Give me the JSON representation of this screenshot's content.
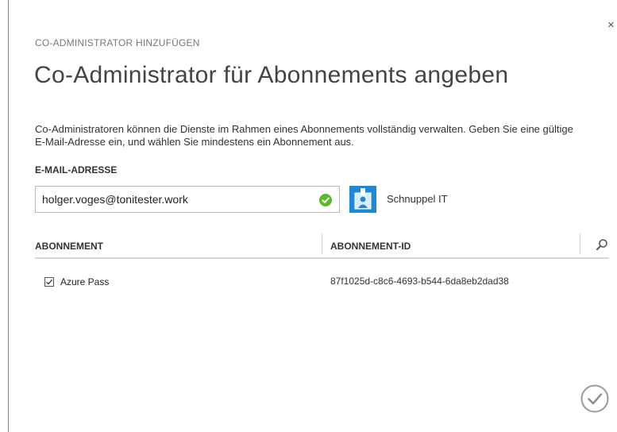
{
  "dialog": {
    "close_label": "×",
    "step_caption": "CO-ADMINISTRATOR HINZUFÜGEN",
    "title": "Co-Administrator für Abonnements angeben",
    "description": "Co-Administratoren können die Dienste im Rahmen eines Abonnements vollständig verwalten. Geben Sie eine gültige E-Mail-Adresse ein, und wählen Sie mindestens ein Abonnement aus."
  },
  "email": {
    "label": "E-MAIL-ADRESSE",
    "value": "holger.voges@tonitester.work",
    "status": "valid",
    "status_icon": "check-circle-icon",
    "status_color": "#5cb82e"
  },
  "tenant": {
    "name": "Schnuppel IT",
    "logo_icon": "tenant-badge-icon",
    "logo_color": "#1e88d4"
  },
  "table": {
    "columns": [
      "ABONNEMENT",
      "ABONNEMENT-ID"
    ],
    "search_icon": "search-icon",
    "rows": [
      {
        "checked": true,
        "name": "Azure Pass",
        "id": "87f1025d-c8c6-4693-b544-6da8eb2dad38"
      }
    ]
  },
  "actions": {
    "confirm_icon": "checkmark-circle-icon"
  }
}
